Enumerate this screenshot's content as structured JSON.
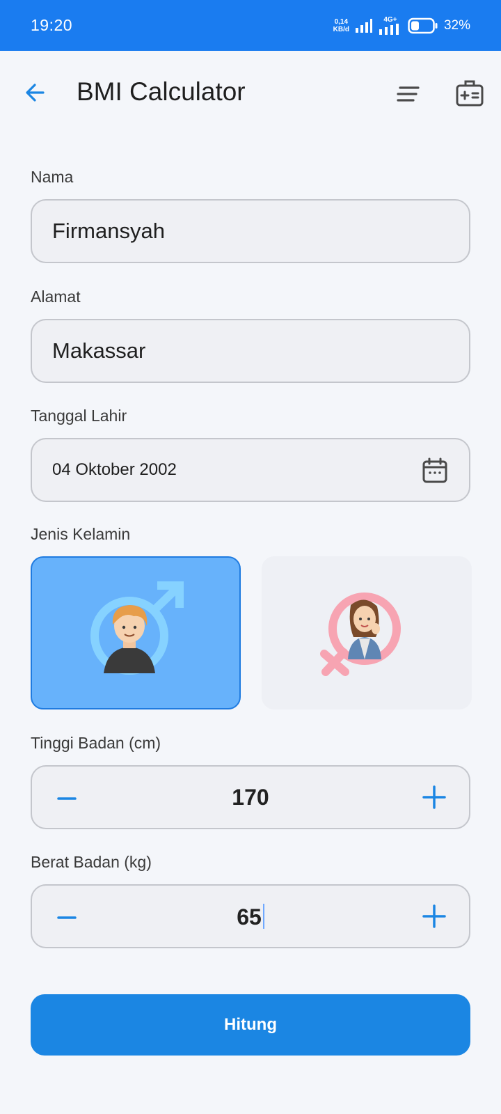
{
  "status_bar": {
    "time": "19:20",
    "net_speed_value": "0,14",
    "net_speed_unit": "KB/d",
    "network_type": "4G+",
    "battery": "32%"
  },
  "app_bar": {
    "title": "BMI Calculator",
    "back_icon": "arrow-left-icon",
    "menu_icon": "menu-lines-icon",
    "kit_icon": "medical-kit-icon"
  },
  "form": {
    "name": {
      "label": "Nama",
      "value": "Firmansyah"
    },
    "address": {
      "label": "Alamat",
      "value": "Makassar"
    },
    "birth_date": {
      "label": "Tanggal Lahir",
      "value": "04 Oktober 2002",
      "icon": "calendar-icon"
    },
    "gender": {
      "label": "Jenis Kelamin",
      "selected": "male",
      "options": [
        "male",
        "female"
      ]
    },
    "height": {
      "label": "Tinggi Badan (cm)",
      "value": "170"
    },
    "weight": {
      "label": "Berat Badan (kg)",
      "value": "65"
    }
  },
  "action": {
    "calculate_label": "Hitung"
  },
  "colors": {
    "status_bar": "#1a7cf0",
    "accent": "#1b86e3",
    "male_selected_bg": "#67b2fb",
    "female_bg": "#eef0f5",
    "page_bg": "#f4f6fa"
  }
}
